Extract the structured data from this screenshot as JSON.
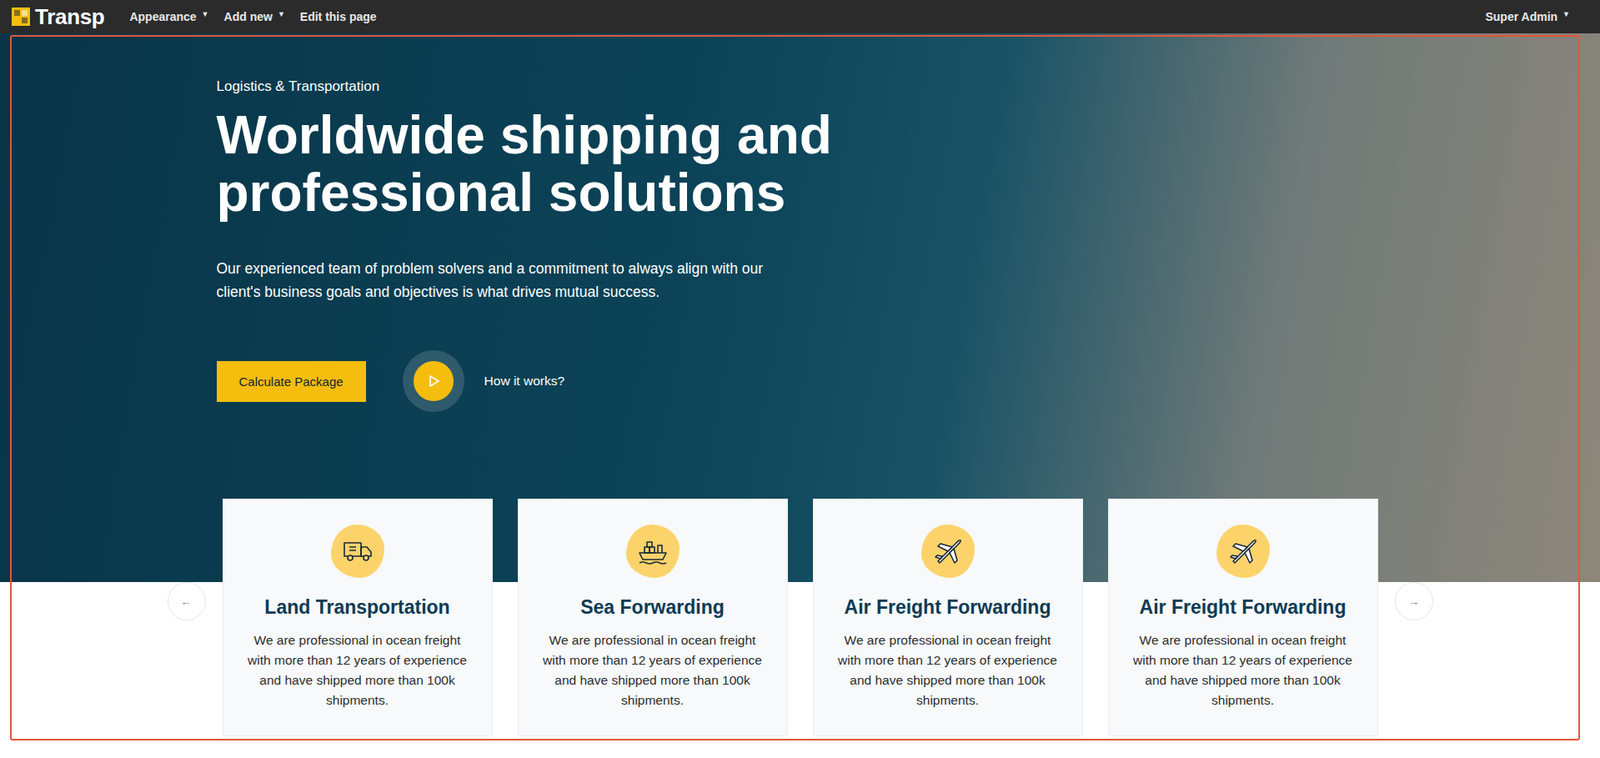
{
  "admin_bar": {
    "logo": "Transp",
    "dropdown_mark": "▼",
    "menu": [
      {
        "label": "Appearance",
        "dropdown": true
      },
      {
        "label": "Add new",
        "dropdown": true
      },
      {
        "label": "Edit this page",
        "dropdown": false
      }
    ],
    "user": {
      "label": "Super Admin",
      "dropdown": true
    }
  },
  "hero": {
    "eyebrow": "Logistics & Transportation",
    "title": "Worldwide shipping and professional solutions",
    "description": "Our experienced team of problem solvers and a commitment to always align with our client's business goals and objectives is what drives mutual success.",
    "primary_button": "Calculate Package",
    "video_link": "How it works?"
  },
  "services": {
    "prev": "←",
    "next": "→",
    "cards": [
      {
        "kind": "land",
        "title": "Land Transportation",
        "text": "We are professional in ocean freight with more than 12 years of experience and have shipped more than 100k shipments."
      },
      {
        "kind": "sea",
        "title": "Sea Forwarding",
        "text": "We are professional in ocean freight with more than 12 years of experience and have shipped more than 100k shipments."
      },
      {
        "kind": "air",
        "title": "Air Freight Forwarding",
        "text": "We are professional in ocean freight with more than 12 years of experience and have shipped more than 100k shipments."
      },
      {
        "kind": "air",
        "title": "Air Freight Forwarding",
        "text": "We are professional in ocean freight with more than 12 years of experience and have shipped more than 100k shipments."
      }
    ]
  }
}
